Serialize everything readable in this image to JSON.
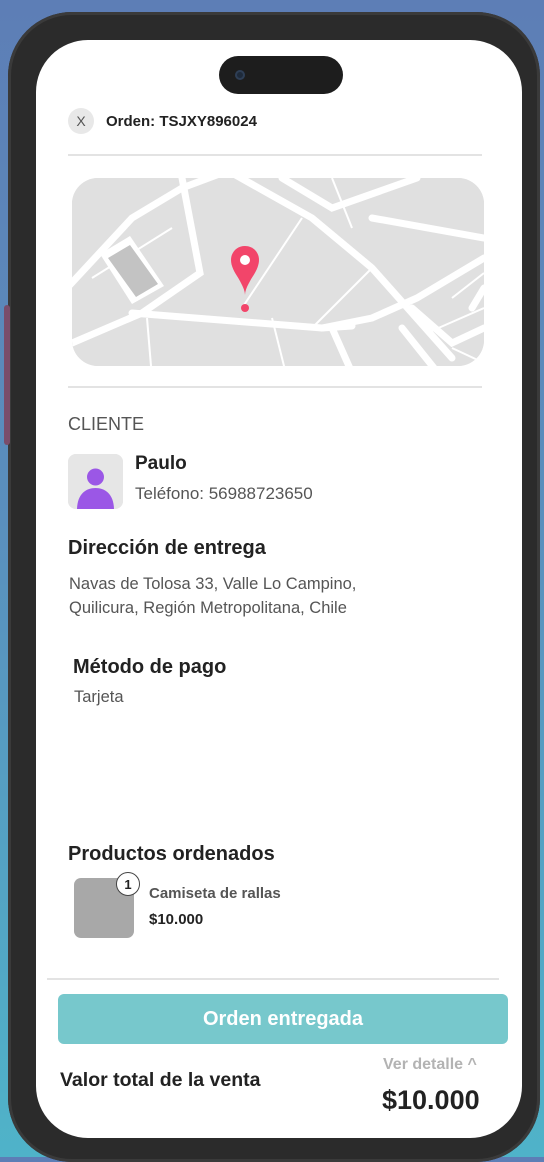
{
  "header": {
    "close_label": "X",
    "order_title": "Orden: TSJXY896024"
  },
  "client": {
    "section_label": "CLIENTE",
    "name": "Paulo",
    "phone": "Teléfono: 56988723650"
  },
  "delivery": {
    "heading": "Dirección de entrega",
    "address_line1": "Navas de Tolosa 33, Valle Lo Campino,",
    "address_line2": "Quilicura, Región Metropolitana, Chile"
  },
  "payment": {
    "heading": "Método de pago",
    "method": "Tarjeta"
  },
  "products": {
    "heading": "Productos ordenados",
    "items": [
      {
        "quantity": "1",
        "name": "Camiseta de rallas",
        "price": "$10.000"
      }
    ]
  },
  "footer": {
    "deliver_button": "Orden entregada",
    "total_label": "Valor total de la venta",
    "detail_link": "Ver detalle ^",
    "total_value": "$10.000"
  },
  "colors": {
    "accent": "#77c8cc",
    "pin": "#f2456a",
    "avatar": "#9b57e6"
  },
  "icons": [
    "close-icon",
    "map-pin-icon",
    "user-avatar-icon"
  ]
}
